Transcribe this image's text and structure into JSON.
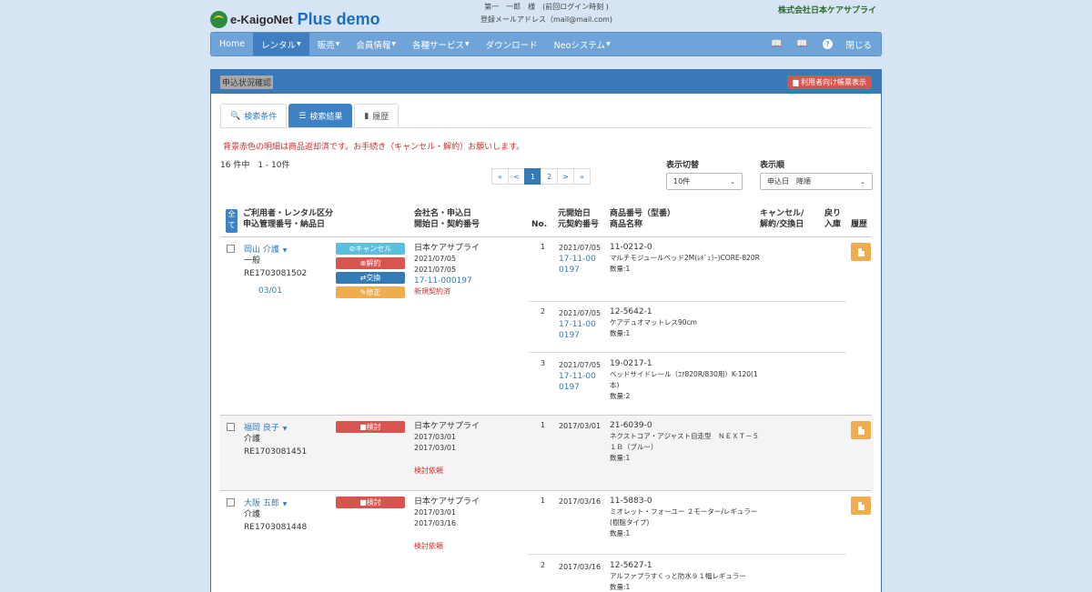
{
  "header": {
    "logo_text": "e-KaigoNet",
    "logo_plus": "Plus demo",
    "user_line1": "第一　一郎　様　(前回ログイン時刻 )",
    "user_line2": "登録メールアドレス（mail@mail.com)",
    "company": "株式会社日本ケアサプライ"
  },
  "nav": {
    "items": [
      {
        "label": "Home"
      },
      {
        "label": "レンタル"
      },
      {
        "label": "販売"
      },
      {
        "label": "会員情報"
      },
      {
        "label": "各種サービス"
      },
      {
        "label": "ダウンロード"
      },
      {
        "label": "Neoシステム"
      }
    ],
    "close": "閉じる"
  },
  "panel": {
    "title": "申込状況確認",
    "report_button": "利用者向け帳票表示"
  },
  "tabs": [
    {
      "label": "検索条件"
    },
    {
      "label": "検索結果"
    },
    {
      "label": "履歴"
    }
  ],
  "warning": "背景赤色の明細は商品返却済です。お手続き（キャンセル・解約）お願いします。",
  "count": "16 件中　1 - 10件",
  "pager": {
    "first": "«",
    "prev": "<",
    "p1": "1",
    "p2": "2",
    "next": ">",
    "last": "»"
  },
  "display": {
    "label": "表示切替",
    "value": "10件"
  },
  "sort": {
    "label": "表示順",
    "value": "申込日　降順"
  },
  "table_head": {
    "all": "全て",
    "col1a": "ご利用者・レンタル区分",
    "col1b": "申込管理番号・納品日",
    "col2a": "会社名・申込日",
    "col2b": "開始日・契約番号",
    "no": "No.",
    "col3a": "元開始日",
    "col3b": "元契約番号",
    "col4a": "商品番号（型番）",
    "col4b": "商品名称",
    "col5a": "キャンセル/",
    "col5b": "解約/交換日",
    "col6a": "戻り",
    "col6b": "入庫",
    "col7": "履歴"
  },
  "rows": [
    {
      "user": "岡山 介護",
      "kubun": "一般",
      "mgmt": "RE1703081502",
      "delivery": "03/01",
      "actions": [
        "キャンセル",
        "解約",
        "交換",
        "修正"
      ],
      "company": "日本ケアサプライ",
      "apply": "2021/07/05",
      "start": "2021/07/05",
      "contract": "17-11-000197",
      "status": "新規契約済",
      "items": [
        {
          "no": "1",
          "odate": "2021/07/05",
          "oc1": "17-11-00",
          "oc2": "0197",
          "code": "11-0212-0",
          "name": "マルチモジュールベッド2M(ﾚｷﾞｭﾗｰ)CORE-820R",
          "qty": "数量:1"
        },
        {
          "no": "2",
          "odate": "2021/07/05",
          "oc1": "17-11-00",
          "oc2": "0197",
          "code": "12-5642-1",
          "name": "ケアデュオマットレス90cm",
          "qty": "数量:1"
        },
        {
          "no": "3",
          "odate": "2021/07/05",
          "oc1": "17-11-00",
          "oc2": "0197",
          "code": "19-0217-1",
          "name": "ベッドサイドレール（ｺｱ820R/830用）K-120(1本)",
          "qty": "数量:2"
        }
      ]
    },
    {
      "user": "福岡 良子",
      "kubun": "介護",
      "mgmt": "RE1703081451",
      "actions": [
        "検討"
      ],
      "company": "日本ケアサプライ",
      "apply": "2017/03/01",
      "start": "2017/03/01",
      "status": "検討依頼",
      "items": [
        {
          "no": "1",
          "odate": "2017/03/01",
          "code": "21-6039-0",
          "name": "ネクストコア・アジャスト自走型　ＮＥＸＴ－５１Ｂ（ブルー）",
          "qty": "数量:1"
        }
      ]
    },
    {
      "user": "大阪 五郎",
      "kubun": "介護",
      "mgmt": "RE1703081448",
      "actions": [
        "検討"
      ],
      "company": "日本ケアサプライ",
      "apply": "2017/03/01",
      "start": "2017/03/16",
      "status": "検討依頼",
      "items": [
        {
          "no": "1",
          "odate": "2017/03/16",
          "code": "11-5883-0",
          "name": "ミオレット・フォーユー ２モーター/レギュラー(樹脂タイプ)",
          "qty": "数量:1"
        },
        {
          "no": "2",
          "odate": "2017/03/16",
          "code": "12-5627-1",
          "name": "アルファプラすくっと防水９１幅レギュラー",
          "qty": "数量:1"
        }
      ]
    }
  ]
}
